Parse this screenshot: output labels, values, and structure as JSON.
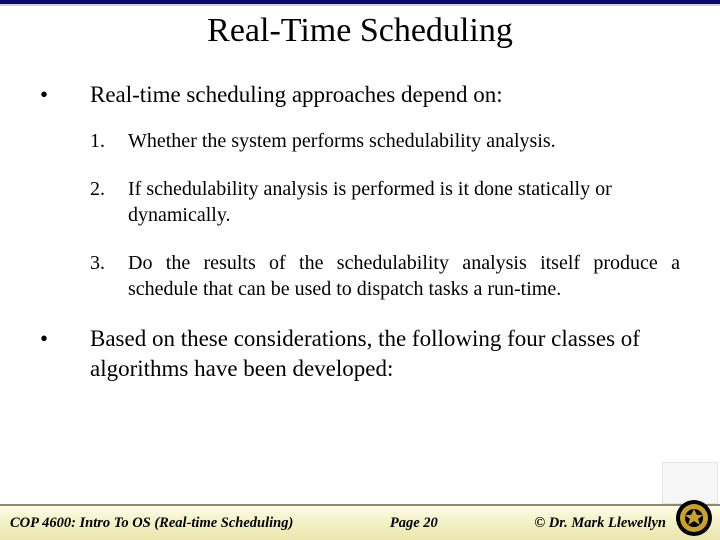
{
  "title": "Real-Time Scheduling",
  "intro": {
    "bullet": "•",
    "text": "Real-time scheduling approaches depend on:"
  },
  "items": [
    {
      "num": "1.",
      "text": "Whether the system performs schedulability analysis."
    },
    {
      "num": "2.",
      "text": "If schedulability analysis is performed is it done statically or dynamically."
    },
    {
      "num": "3.",
      "text": "Do the results of the  schedulability analysis itself produce a schedule that can be used to dispatch tasks a run-time."
    }
  ],
  "outro": {
    "bullet": "•",
    "text": "Based on these considerations, the following four classes of algorithms have been developed:"
  },
  "footer": {
    "left": "COP 4600: Intro To OS  (Real-time Scheduling)",
    "center": "Page 20",
    "right": "© Dr. Mark Llewellyn"
  }
}
